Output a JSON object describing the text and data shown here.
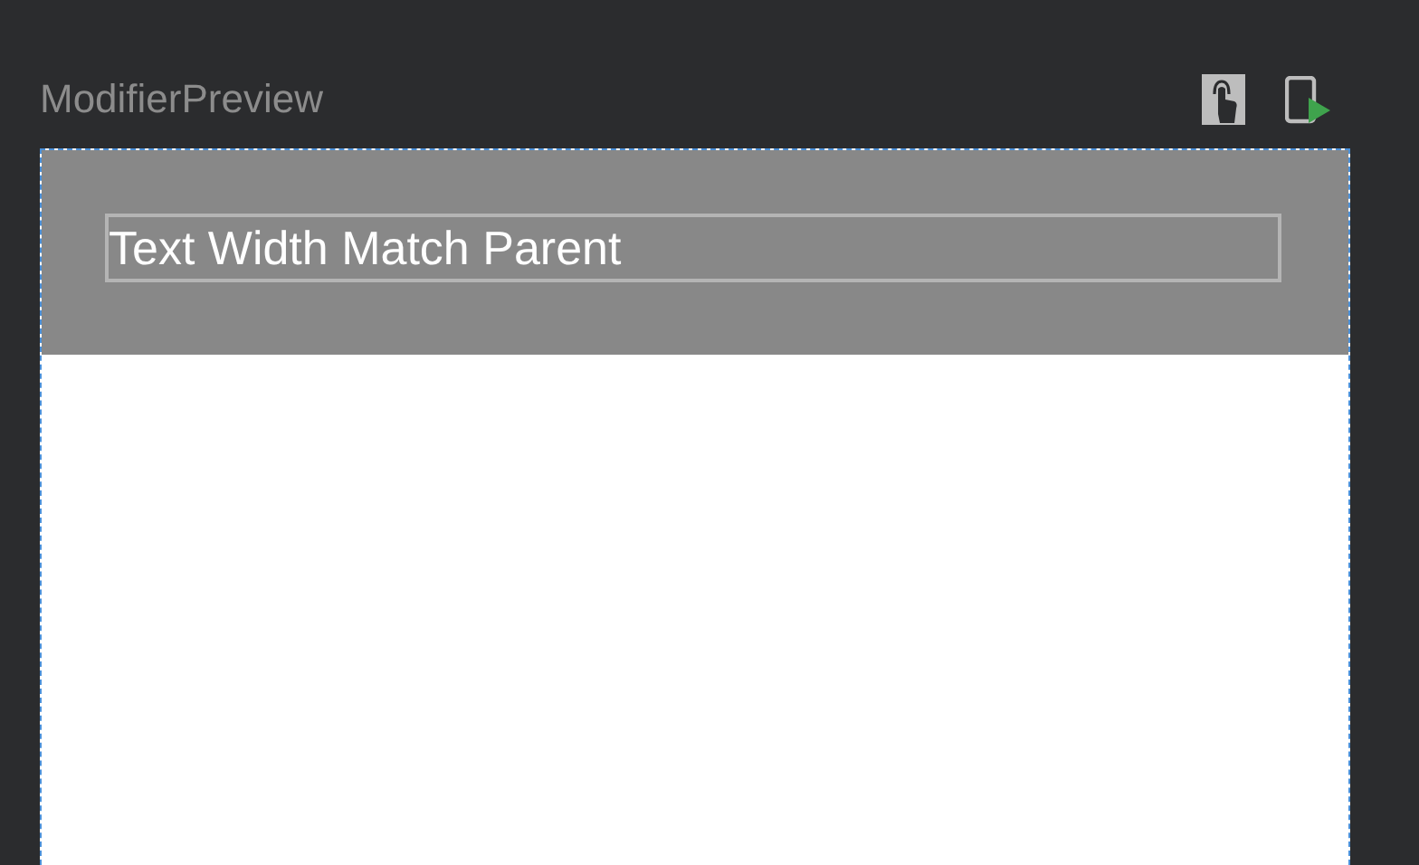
{
  "preview": {
    "title": "ModifierPreview",
    "text": "Text Width Match Parent"
  }
}
